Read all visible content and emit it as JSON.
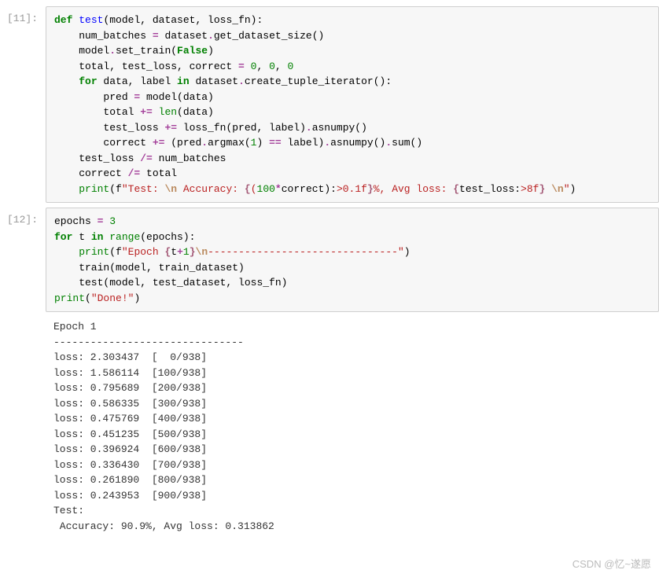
{
  "cells": [
    {
      "prompt": "[11]:",
      "code_tokens": [
        {
          "t": "def ",
          "c": "k-def"
        },
        {
          "t": "test",
          "c": "fn-name"
        },
        {
          "t": "(model, dataset, loss_fn):\n"
        },
        {
          "t": "    num_batches "
        },
        {
          "t": "=",
          "c": "op"
        },
        {
          "t": " dataset"
        },
        {
          "t": ".",
          "c": "op"
        },
        {
          "t": "get_dataset_size()\n"
        },
        {
          "t": "    model"
        },
        {
          "t": ".",
          "c": "op"
        },
        {
          "t": "set_train("
        },
        {
          "t": "False",
          "c": "bool"
        },
        {
          "t": ")\n"
        },
        {
          "t": "    total, test_loss, correct "
        },
        {
          "t": "=",
          "c": "op"
        },
        {
          "t": " "
        },
        {
          "t": "0",
          "c": "num"
        },
        {
          "t": ", "
        },
        {
          "t": "0",
          "c": "num"
        },
        {
          "t": ", "
        },
        {
          "t": "0",
          "c": "num"
        },
        {
          "t": "\n"
        },
        {
          "t": "    "
        },
        {
          "t": "for",
          "c": "k-for"
        },
        {
          "t": " data, label "
        },
        {
          "t": "in",
          "c": "k-in"
        },
        {
          "t": " dataset"
        },
        {
          "t": ".",
          "c": "op"
        },
        {
          "t": "create_tuple_iterator():\n"
        },
        {
          "t": "        pred "
        },
        {
          "t": "=",
          "c": "op"
        },
        {
          "t": " model(data)\n"
        },
        {
          "t": "        total "
        },
        {
          "t": "+=",
          "c": "op"
        },
        {
          "t": " "
        },
        {
          "t": "len",
          "c": "builtin"
        },
        {
          "t": "(data)\n"
        },
        {
          "t": "        test_loss "
        },
        {
          "t": "+=",
          "c": "op"
        },
        {
          "t": " loss_fn(pred, label)"
        },
        {
          "t": ".",
          "c": "op"
        },
        {
          "t": "asnumpy()\n"
        },
        {
          "t": "        correct "
        },
        {
          "t": "+=",
          "c": "op"
        },
        {
          "t": " (pred"
        },
        {
          "t": ".",
          "c": "op"
        },
        {
          "t": "argmax("
        },
        {
          "t": "1",
          "c": "num"
        },
        {
          "t": ") "
        },
        {
          "t": "==",
          "c": "op"
        },
        {
          "t": " label)"
        },
        {
          "t": ".",
          "c": "op"
        },
        {
          "t": "asnumpy()"
        },
        {
          "t": ".",
          "c": "op"
        },
        {
          "t": "sum()\n"
        },
        {
          "t": "    test_loss "
        },
        {
          "t": "/=",
          "c": "op"
        },
        {
          "t": " num_batches\n"
        },
        {
          "t": "    correct "
        },
        {
          "t": "/=",
          "c": "op"
        },
        {
          "t": " total\n"
        },
        {
          "t": "    "
        },
        {
          "t": "print",
          "c": "builtin"
        },
        {
          "t": "(f"
        },
        {
          "t": "\"Test: ",
          "c": "str"
        },
        {
          "t": "\\n",
          "c": "str-esc"
        },
        {
          "t": " Accuracy: ",
          "c": "str"
        },
        {
          "t": "{",
          "c": "str-fmt"
        },
        {
          "t": "(",
          "c": "str"
        },
        {
          "t": "100",
          "c": "num"
        },
        {
          "t": "*",
          "c": "op"
        },
        {
          "t": "correct):"
        },
        {
          "t": ">0.1",
          "c": "str"
        },
        {
          "t": "f",
          "c": "str"
        },
        {
          "t": "}",
          "c": "str-fmt"
        },
        {
          "t": "%, Avg loss: ",
          "c": "str"
        },
        {
          "t": "{",
          "c": "str-fmt"
        },
        {
          "t": "test_loss:"
        },
        {
          "t": ">8",
          "c": "str"
        },
        {
          "t": "f",
          "c": "str"
        },
        {
          "t": "}",
          "c": "str-fmt"
        },
        {
          "t": " ",
          "c": "str"
        },
        {
          "t": "\\n",
          "c": "str-esc"
        },
        {
          "t": "\"",
          "c": "str"
        },
        {
          "t": ")"
        }
      ]
    },
    {
      "prompt": "[12]:",
      "code_tokens": [
        {
          "t": "epochs "
        },
        {
          "t": "=",
          "c": "op"
        },
        {
          "t": " "
        },
        {
          "t": "3",
          "c": "num"
        },
        {
          "t": "\n"
        },
        {
          "t": "for",
          "c": "k-for"
        },
        {
          "t": " t "
        },
        {
          "t": "in",
          "c": "k-in"
        },
        {
          "t": " "
        },
        {
          "t": "range",
          "c": "builtin"
        },
        {
          "t": "(epochs):\n"
        },
        {
          "t": "    "
        },
        {
          "t": "print",
          "c": "builtin"
        },
        {
          "t": "(f"
        },
        {
          "t": "\"Epoch ",
          "c": "str"
        },
        {
          "t": "{",
          "c": "str-fmt"
        },
        {
          "t": "t"
        },
        {
          "t": "+",
          "c": "op"
        },
        {
          "t": "1",
          "c": "num"
        },
        {
          "t": "}",
          "c": "str-fmt"
        },
        {
          "t": "\\n",
          "c": "str-esc"
        },
        {
          "t": "-------------------------------\"",
          "c": "str"
        },
        {
          "t": ")\n"
        },
        {
          "t": "    train(model, train_dataset)\n"
        },
        {
          "t": "    test(model, test_dataset, loss_fn)\n"
        },
        {
          "t": "print",
          "c": "builtin"
        },
        {
          "t": "("
        },
        {
          "t": "\"Done!\"",
          "c": "str"
        },
        {
          "t": ")"
        }
      ],
      "output": "Epoch 1\n-------------------------------\nloss: 2.303437  [  0/938]\nloss: 1.586114  [100/938]\nloss: 0.795689  [200/938]\nloss: 0.586335  [300/938]\nloss: 0.475769  [400/938]\nloss: 0.451235  [500/938]\nloss: 0.396924  [600/938]\nloss: 0.336430  [700/938]\nloss: 0.261890  [800/938]\nloss: 0.243953  [900/938]\nTest:\n Accuracy: 90.9%, Avg loss: 0.313862"
    }
  ],
  "watermark": "CSDN @忆~遂愿"
}
